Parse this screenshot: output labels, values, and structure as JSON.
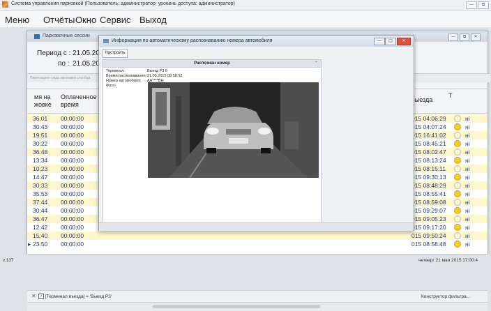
{
  "app": {
    "title": "Система управления парковкой (Пользователь: администратор, уровень доступа: администратор)"
  },
  "menu": [
    "Меню",
    "Отчёты",
    "Окно",
    "Сервис",
    "Выход"
  ],
  "sessions_window": {
    "title": "Парковочные сессии",
    "period_from_label": "Период с :",
    "period_from_value": "21.05.2015",
    "period_to_label": "по :",
    "period_to_value": "21.05.2015",
    "group_hint": "Перетащите сюда заголовок столбца",
    "columns": {
      "entry": "мя на\nжовке",
      "paid": "Оплаченное\nвремя",
      "exit": "выезда",
      "t": "Т"
    },
    "rows": [
      {
        "entry": "36:01",
        "paid": "00:00:00",
        "exit": "015 04:06:29",
        "status": "empty"
      },
      {
        "entry": "30:43",
        "paid": "00:00:00",
        "exit": "015 04:07:24",
        "status": "yellow"
      },
      {
        "entry": "19:51",
        "paid": "00:00:00",
        "exit": "015 16:41:02",
        "status": "empty"
      },
      {
        "entry": "30:22",
        "paid": "00:00:00",
        "exit": "015 08:45:21",
        "status": "yellow"
      },
      {
        "entry": "36:48",
        "paid": "00:00:00",
        "exit": "015 08:02:47",
        "status": "empty"
      },
      {
        "entry": "13:34",
        "paid": "00:00:00",
        "exit": "015 08:13:24",
        "status": "yellow"
      },
      {
        "entry": "10:23",
        "paid": "00:00:00",
        "exit": "015 08:15:11",
        "status": "empty"
      },
      {
        "entry": "14:47",
        "paid": "00:00:00",
        "exit": "015 09:30:13",
        "status": "yellow"
      },
      {
        "entry": "30:33",
        "paid": "00:00:00",
        "exit": "015 08:48:29",
        "status": "empty"
      },
      {
        "entry": "35:53",
        "paid": "00:00:00",
        "exit": "015 08:55:41",
        "status": "yellow"
      },
      {
        "entry": "37:44",
        "paid": "00:00:00",
        "exit": "015 08:59:08",
        "status": "empty"
      },
      {
        "entry": "30:44",
        "paid": "00:00:00",
        "exit": "015 09:29:07",
        "status": "yellow"
      },
      {
        "entry": "36:47",
        "paid": "00:00:00",
        "exit": "015 09:05:23",
        "status": "empty"
      },
      {
        "entry": "12:42",
        "paid": "00:00:00",
        "exit": "015 09:17:20",
        "status": "yellow"
      },
      {
        "entry": "15:40",
        "paid": "00:00:00",
        "exit": "015 09:50:24",
        "status": "empty"
      },
      {
        "entry": "23:50",
        "paid": "00:00:00",
        "exit": "015 08:58:48",
        "status": "yellow"
      }
    ],
    "row_suffix": "нi",
    "current_row_marker": "▸",
    "filter_text": "[Терминал въезда] = 'Выезд Р3'",
    "filter_builder": "Конструктор фильтра..."
  },
  "dialog": {
    "title": "Информация по автоматическому распознаванию номера автомобиля",
    "configure_label": "Настроить",
    "panel_title": "Распознан номер",
    "fields": [
      {
        "label": "Терминал:",
        "value": "Выезд Р3 б"
      },
      {
        "label": "Время распознавания:",
        "value": "21.05.2015 08:58:52"
      },
      {
        "label": "Номер автомобиля:",
        "value": "АА****ВН"
      },
      {
        "label": "Фото:",
        "value": ""
      }
    ]
  },
  "statusbar": {
    "version": "v.137",
    "datetime": "четверг 21 мая 2015 17:00:4"
  },
  "colors": {
    "alt_row": "#fdf6cf",
    "status_yellow": "#f5cf2b",
    "dialog_close": "#d9543e"
  }
}
